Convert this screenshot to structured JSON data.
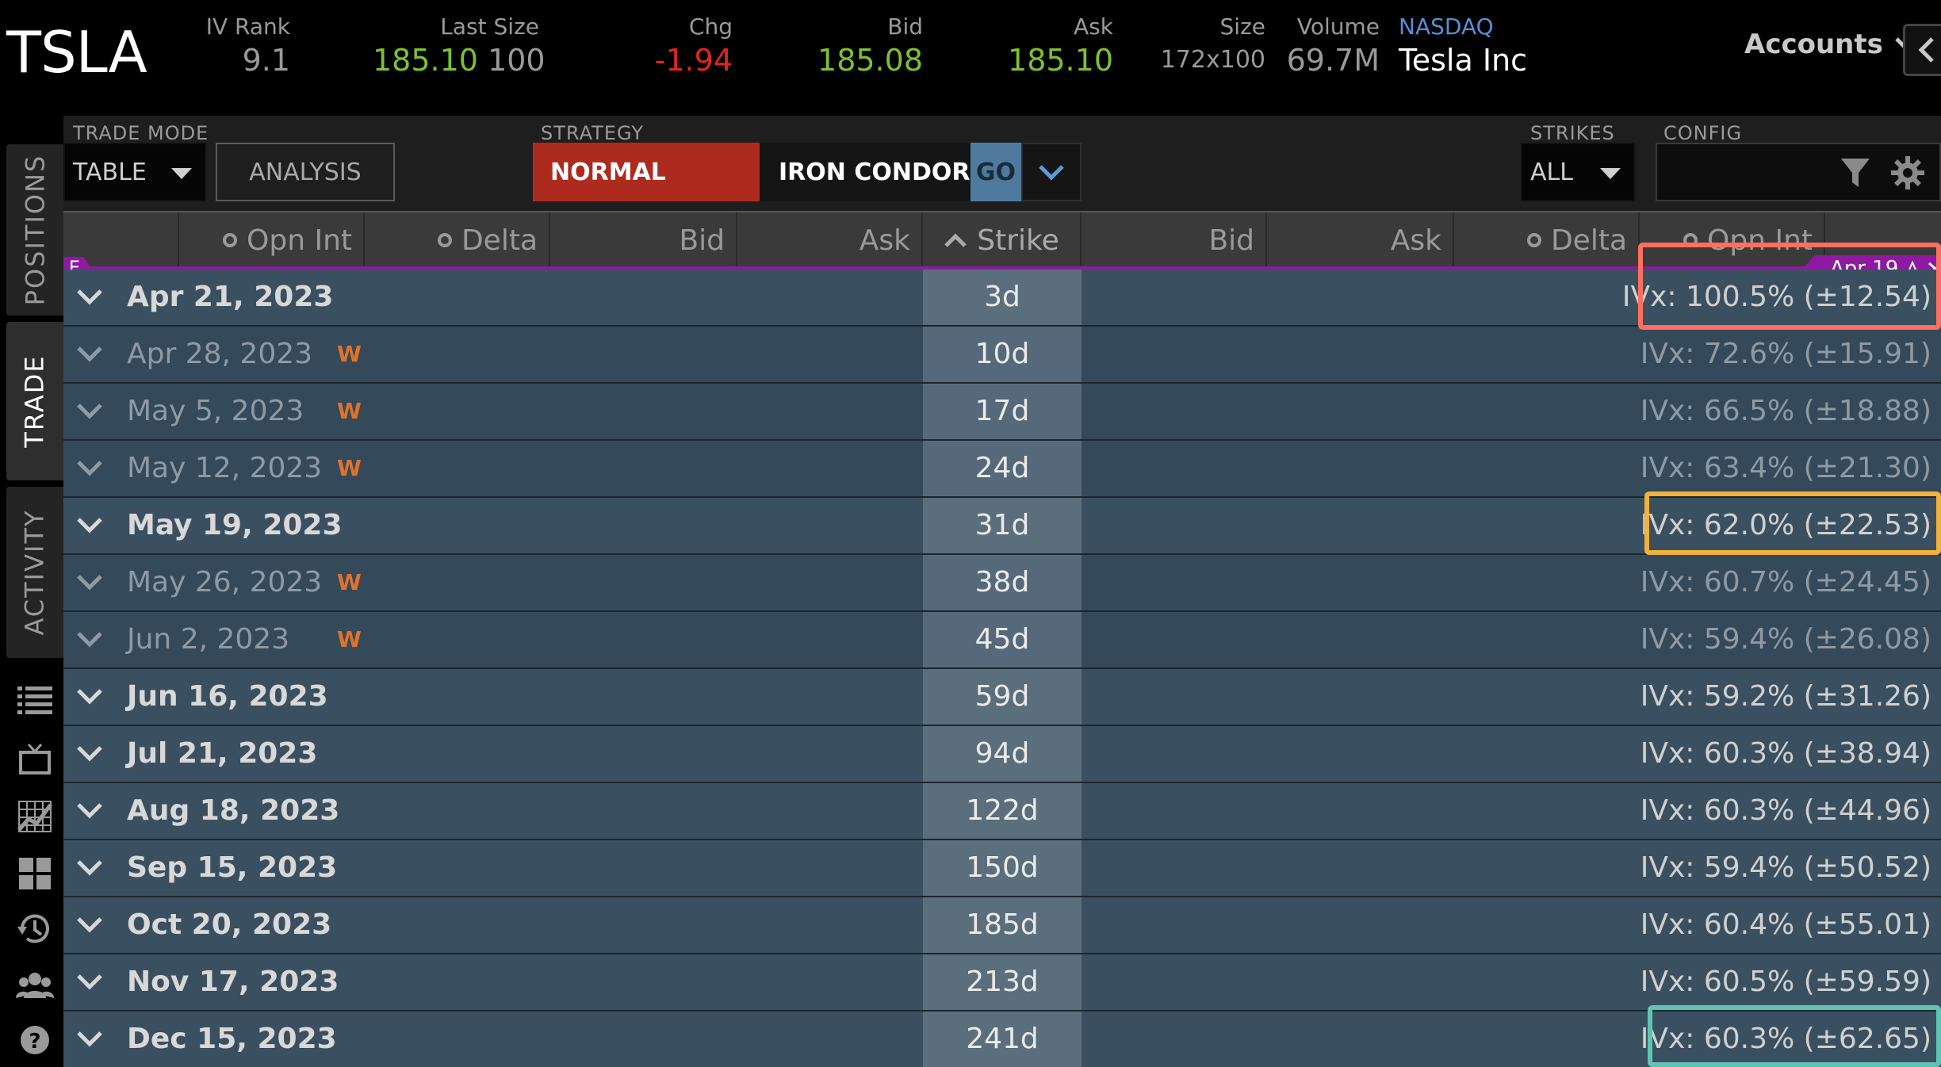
{
  "header": {
    "symbol": "TSLA",
    "iv_rank_label": "IV Rank",
    "iv_rank_value": "9.1",
    "last_size_label": "Last Size",
    "last_price": "185.10",
    "last_size": "100",
    "chg_label": "Chg",
    "chg_value": "-1.94",
    "bid_label": "Bid",
    "bid_value": "185.08",
    "ask_label": "Ask",
    "ask_value": "185.10",
    "size_label": "Size",
    "size_value": "172x100",
    "volume_label": "Volume",
    "volume_value": "69.7M",
    "exchange": "NASDAQ",
    "company": "Tesla Inc",
    "accounts_label": "Accounts"
  },
  "sidebar": {
    "tabs": [
      "POSITIONS",
      "TRADE",
      "ACTIVITY"
    ],
    "active_tab": "TRADE",
    "icons": [
      "list-icon",
      "tv-icon",
      "chart-icon",
      "grid-icon",
      "history-icon",
      "users-icon",
      "help-icon"
    ]
  },
  "toolbar": {
    "trade_mode_label": "TRADE MODE",
    "trade_mode_value": "TABLE",
    "analysis_label": "ANALYSIS",
    "strategy_label": "STRATEGY",
    "strategy_normal": "NORMAL",
    "strategy_selected": "IRON CONDOR",
    "go_label": "GO",
    "strikes_label": "STRIKES",
    "strikes_value": "ALL",
    "config_label": "CONFIG"
  },
  "columns": {
    "call_open_int": "Opn Int",
    "call_delta": "Delta",
    "call_bid": "Bid",
    "call_ask": "Ask",
    "strike": "Strike",
    "put_bid": "Bid",
    "put_ask": "Ask",
    "put_delta": "Delta",
    "put_open_int": "Opn Int"
  },
  "earnings": {
    "marker": "E",
    "date": "Apr 19"
  },
  "expirations": [
    {
      "date": "Apr 21, 2023",
      "weekly": "",
      "days": "3d",
      "ivx": "IVx: 100.5% (±12.54)"
    },
    {
      "date": "Apr 28, 2023",
      "weekly": "W",
      "days": "10d",
      "ivx": "IVx: 72.6% (±15.91)"
    },
    {
      "date": "May 5, 2023",
      "weekly": "W",
      "days": "17d",
      "ivx": "IVx: 66.5% (±18.88)"
    },
    {
      "date": "May 12, 2023",
      "weekly": "W",
      "days": "24d",
      "ivx": "IVx: 63.4% (±21.30)"
    },
    {
      "date": "May 19, 2023",
      "weekly": "",
      "days": "31d",
      "ivx": "IVx: 62.0% (±22.53)"
    },
    {
      "date": "May 26, 2023",
      "weekly": "W",
      "days": "38d",
      "ivx": "IVx: 60.7% (±24.45)"
    },
    {
      "date": "Jun 2, 2023",
      "weekly": "W",
      "days": "45d",
      "ivx": "IVx: 59.4% (±26.08)"
    },
    {
      "date": "Jun 16, 2023",
      "weekly": "",
      "days": "59d",
      "ivx": "IVx: 59.2% (±31.26)"
    },
    {
      "date": "Jul 21, 2023",
      "weekly": "",
      "days": "94d",
      "ivx": "IVx: 60.3% (±38.94)"
    },
    {
      "date": "Aug 18, 2023",
      "weekly": "",
      "days": "122d",
      "ivx": "IVx: 60.3% (±44.96)"
    },
    {
      "date": "Sep 15, 2023",
      "weekly": "",
      "days": "150d",
      "ivx": "IVx: 59.4% (±50.52)"
    },
    {
      "date": "Oct 20, 2023",
      "weekly": "",
      "days": "185d",
      "ivx": "IVx: 60.4% (±55.01)"
    },
    {
      "date": "Nov 17, 2023",
      "weekly": "",
      "days": "213d",
      "ivx": "IVx: 60.5% (±59.59)"
    },
    {
      "date": "Dec 15, 2023",
      "weekly": "",
      "days": "241d",
      "ivx": "IVx: 60.3% (±62.65)"
    }
  ],
  "colors": {
    "positive": "#7ec12f",
    "negative": "#e0261d",
    "normal_strategy": "#ad2a1f",
    "earnings": "#8d1aa0",
    "weekly_badge": "#e0722a",
    "highlight_red": "#ff6f5e",
    "highlight_yellow": "#f2b13b",
    "highlight_teal": "#5ec4b3"
  }
}
